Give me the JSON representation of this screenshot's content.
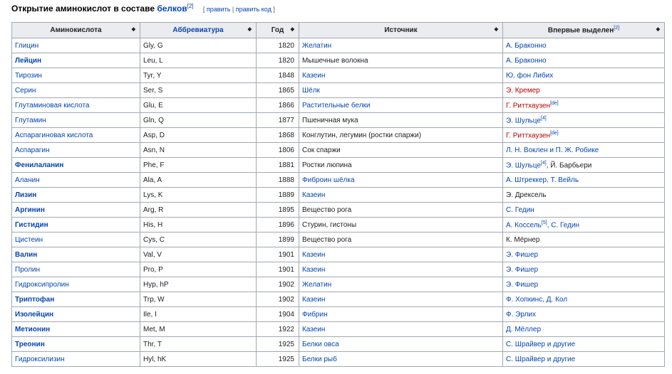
{
  "heading": {
    "prefix": "Открытие аминокислот в составе ",
    "link": "белков",
    "ref": "[2]",
    "edit_open": "[ ",
    "edit_label": "править",
    "edit_sep": " | ",
    "edit_code_label": "править код",
    "edit_close": " ]"
  },
  "table": {
    "columns": [
      {
        "label": "Аминокислота",
        "link": false,
        "ref": ""
      },
      {
        "label": "Аббревиатура",
        "link": true,
        "ref": ""
      },
      {
        "label": "Год",
        "link": false,
        "ref": ""
      },
      {
        "label": "Источник",
        "link": false,
        "ref": ""
      },
      {
        "label": "Впервые выделен",
        "link": false,
        "ref": "[2]"
      }
    ],
    "sort_icon": "◆",
    "rows": [
      {
        "name": "Глицин",
        "bold": false,
        "abbr": "Gly, G",
        "year": "1820",
        "source": "Желатин",
        "source_link": true,
        "discoverer": [
          {
            "t": "А. Браконно",
            "k": "link"
          }
        ]
      },
      {
        "name": "Лейцин",
        "bold": true,
        "abbr": "Leu, L",
        "year": "1820",
        "source": "Мышечные волокна",
        "source_link": false,
        "discoverer": [
          {
            "t": "А. Браконно",
            "k": "link"
          }
        ]
      },
      {
        "name": "Тирозин",
        "bold": false,
        "abbr": "Tyr, Y",
        "year": "1848",
        "source": "Казеин",
        "source_link": true,
        "discoverer": [
          {
            "t": "Ю. фон Либих",
            "k": "link"
          }
        ]
      },
      {
        "name": "Серин",
        "bold": false,
        "abbr": "Ser, S",
        "year": "1865",
        "source": "Шёлк",
        "source_link": true,
        "discoverer": [
          {
            "t": "Э. Кремер",
            "k": "red"
          }
        ]
      },
      {
        "name": "Глутаминовая кислота",
        "bold": false,
        "abbr": "Glu, E",
        "year": "1866",
        "source": "Растительные белки",
        "source_link": true,
        "discoverer": [
          {
            "t": "Г. Риттхаузен",
            "k": "red"
          },
          {
            "t": "[de]",
            "k": "sup"
          }
        ]
      },
      {
        "name": "Глутамин",
        "bold": false,
        "abbr": "Gln, Q",
        "year": "1877",
        "source": "Пшеничная мука",
        "source_link": false,
        "discoverer": [
          {
            "t": "Э. Шульце",
            "k": "link"
          },
          {
            "t": "[4]",
            "k": "sup"
          }
        ]
      },
      {
        "name": "Аспарагиновая кислота",
        "bold": false,
        "abbr": "Asp, D",
        "year": "1868",
        "source": "Конглутин, легумин (ростки спаржи)",
        "source_link": false,
        "discoverer": [
          {
            "t": "Г. Риттхаузен",
            "k": "red"
          },
          {
            "t": "[de]",
            "k": "sup"
          }
        ]
      },
      {
        "name": "Аспарагин",
        "bold": false,
        "abbr": "Asn, N",
        "year": "1806",
        "source": "Сок спаржи",
        "source_link": false,
        "discoverer": [
          {
            "t": "Л. Н. Воклен и П. Ж. Робике",
            "k": "link"
          }
        ]
      },
      {
        "name": "Фенилаланин",
        "bold": true,
        "abbr": "Phe, F",
        "year": "1881",
        "source": "Ростки люпина",
        "source_link": false,
        "discoverer": [
          {
            "t": "Э. Шульце",
            "k": "link"
          },
          {
            "t": "[4]",
            "k": "sup"
          },
          {
            "t": ", Й. Барбьери",
            "k": "plain"
          }
        ]
      },
      {
        "name": "Аланин",
        "bold": false,
        "abbr": "Ala, A",
        "year": "1888",
        "source": "Фиброин шёлка",
        "source_link": true,
        "discoverer": [
          {
            "t": "А. Штреккер, Т. Вейль",
            "k": "link"
          }
        ]
      },
      {
        "name": "Лизин",
        "bold": true,
        "abbr": "Lys, K",
        "year": "1889",
        "source": "Казеин",
        "source_link": true,
        "discoverer": [
          {
            "t": "Э. Дрексель",
            "k": "plain"
          }
        ]
      },
      {
        "name": "Аргинин",
        "bold": true,
        "abbr": "Arg, R",
        "year": "1895",
        "source": "Вещество рога",
        "source_link": false,
        "discoverer": [
          {
            "t": "С. Гедин",
            "k": "link"
          }
        ]
      },
      {
        "name": "Гистидин",
        "bold": true,
        "abbr": "His, H",
        "year": "1896",
        "source": "Стурин, гистоны",
        "source_link": false,
        "discoverer": [
          {
            "t": "А. Коссель",
            "k": "link"
          },
          {
            "t": "[5]",
            "k": "sup"
          },
          {
            "t": ", С. Гедин",
            "k": "link"
          }
        ]
      },
      {
        "name": "Цистеин",
        "bold": false,
        "abbr": "Cys, C",
        "year": "1899",
        "source": "Вещество рога",
        "source_link": false,
        "discoverer": [
          {
            "t": "К. Мёрнер",
            "k": "plain"
          }
        ]
      },
      {
        "name": "Валин",
        "bold": true,
        "abbr": "Val, V",
        "year": "1901",
        "source": "Казеин",
        "source_link": true,
        "discoverer": [
          {
            "t": "Э. Фишер",
            "k": "link"
          }
        ]
      },
      {
        "name": "Пролин",
        "bold": false,
        "abbr": "Pro, P",
        "year": "1901",
        "source": "Казеин",
        "source_link": true,
        "discoverer": [
          {
            "t": "Э. Фишер",
            "k": "link"
          }
        ]
      },
      {
        "name": "Гидроксипролин",
        "bold": false,
        "abbr": "Hyp, hP",
        "year": "1902",
        "source": "Желатин",
        "source_link": true,
        "discoverer": [
          {
            "t": "Э. Фишер",
            "k": "link"
          }
        ]
      },
      {
        "name": "Триптофан",
        "bold": true,
        "abbr": "Trp, W",
        "year": "1902",
        "source": "Казеин",
        "source_link": true,
        "discoverer": [
          {
            "t": "Ф. Хопкинс, Д. Кол",
            "k": "link"
          }
        ]
      },
      {
        "name": "Изолейцин",
        "bold": true,
        "abbr": "Ile, I",
        "year": "1904",
        "source": "Фибрин",
        "source_link": true,
        "discoverer": [
          {
            "t": "Ф. Эрлих",
            "k": "link"
          }
        ]
      },
      {
        "name": "Метионин",
        "bold": true,
        "abbr": "Met, M",
        "year": "1922",
        "source": "Казеин",
        "source_link": true,
        "discoverer": [
          {
            "t": "Д. Мёллер",
            "k": "link"
          }
        ]
      },
      {
        "name": "Треонин",
        "bold": true,
        "abbr": "Thr, T",
        "year": "1925",
        "source": "Белки овса",
        "source_link": true,
        "discoverer": [
          {
            "t": "С. Шрайвер и другие",
            "k": "link"
          }
        ]
      },
      {
        "name": "Гидроксилизин",
        "bold": false,
        "abbr": "Hyl, hK",
        "year": "1925",
        "source": "Белки рыб",
        "source_link": true,
        "discoverer": [
          {
            "t": "С. Шрайвер и другие",
            "k": "link"
          }
        ]
      }
    ]
  },
  "colors": {
    "link": "#0645ad",
    "redlink": "#ba0000",
    "header_bg": "#eaecf0",
    "border": "#a2a9b1"
  }
}
